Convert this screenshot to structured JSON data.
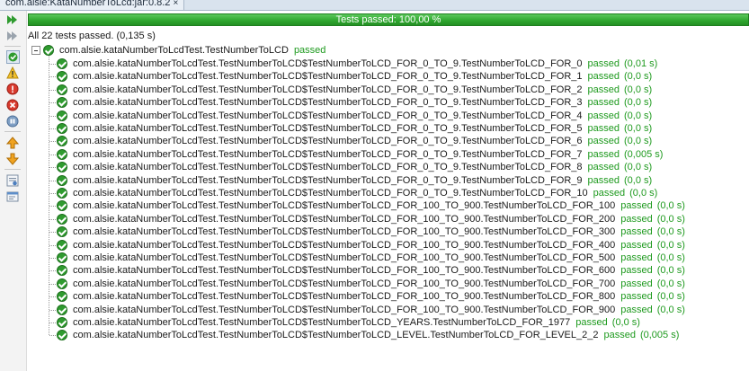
{
  "tab": {
    "title": "com.alsie:KataNumberToLcd:jar:0.8.2",
    "close": "×"
  },
  "progress": {
    "label": "Tests passed: 100,00 %",
    "fraction": 1.0,
    "color": "#2ea62e"
  },
  "summary": "All 22 tests passed. (0,135 s)",
  "suite": {
    "name": "com.alsie.kataNumberToLcdTest.TestNumberToLCD",
    "status": "passed"
  },
  "tests": [
    {
      "name": "com.alsie.kataNumberToLcdTest.TestNumberToLCD$TestNumberToLCD_FOR_0_TO_9.TestNumberToLCD_FOR_0",
      "status": "passed",
      "time": "(0,01 s)"
    },
    {
      "name": "com.alsie.kataNumberToLcdTest.TestNumberToLCD$TestNumberToLCD_FOR_0_TO_9.TestNumberToLCD_FOR_1",
      "status": "passed",
      "time": "(0,0 s)"
    },
    {
      "name": "com.alsie.kataNumberToLcdTest.TestNumberToLCD$TestNumberToLCD_FOR_0_TO_9.TestNumberToLCD_FOR_2",
      "status": "passed",
      "time": "(0,0 s)"
    },
    {
      "name": "com.alsie.kataNumberToLcdTest.TestNumberToLCD$TestNumberToLCD_FOR_0_TO_9.TestNumberToLCD_FOR_3",
      "status": "passed",
      "time": "(0,0 s)"
    },
    {
      "name": "com.alsie.kataNumberToLcdTest.TestNumberToLCD$TestNumberToLCD_FOR_0_TO_9.TestNumberToLCD_FOR_4",
      "status": "passed",
      "time": "(0,0 s)"
    },
    {
      "name": "com.alsie.kataNumberToLcdTest.TestNumberToLCD$TestNumberToLCD_FOR_0_TO_9.TestNumberToLCD_FOR_5",
      "status": "passed",
      "time": "(0,0 s)"
    },
    {
      "name": "com.alsie.kataNumberToLcdTest.TestNumberToLCD$TestNumberToLCD_FOR_0_TO_9.TestNumberToLCD_FOR_6",
      "status": "passed",
      "time": "(0,0 s)"
    },
    {
      "name": "com.alsie.kataNumberToLcdTest.TestNumberToLCD$TestNumberToLCD_FOR_0_TO_9.TestNumberToLCD_FOR_7",
      "status": "passed",
      "time": "(0,005 s)"
    },
    {
      "name": "com.alsie.kataNumberToLcdTest.TestNumberToLCD$TestNumberToLCD_FOR_0_TO_9.TestNumberToLCD_FOR_8",
      "status": "passed",
      "time": "(0,0 s)"
    },
    {
      "name": "com.alsie.kataNumberToLcdTest.TestNumberToLCD$TestNumberToLCD_FOR_0_TO_9.TestNumberToLCD_FOR_9",
      "status": "passed",
      "time": "(0,0 s)"
    },
    {
      "name": "com.alsie.kataNumberToLcdTest.TestNumberToLCD$TestNumberToLCD_FOR_0_TO_9.TestNumberToLCD_FOR_10",
      "status": "passed",
      "time": "(0,0 s)"
    },
    {
      "name": "com.alsie.kataNumberToLcdTest.TestNumberToLCD$TestNumberToLCD_FOR_100_TO_900.TestNumberToLCD_FOR_100",
      "status": "passed",
      "time": "(0,0 s)"
    },
    {
      "name": "com.alsie.kataNumberToLcdTest.TestNumberToLCD$TestNumberToLCD_FOR_100_TO_900.TestNumberToLCD_FOR_200",
      "status": "passed",
      "time": "(0,0 s)"
    },
    {
      "name": "com.alsie.kataNumberToLcdTest.TestNumberToLCD$TestNumberToLCD_FOR_100_TO_900.TestNumberToLCD_FOR_300",
      "status": "passed",
      "time": "(0,0 s)"
    },
    {
      "name": "com.alsie.kataNumberToLcdTest.TestNumberToLCD$TestNumberToLCD_FOR_100_TO_900.TestNumberToLCD_FOR_400",
      "status": "passed",
      "time": "(0,0 s)"
    },
    {
      "name": "com.alsie.kataNumberToLcdTest.TestNumberToLCD$TestNumberToLCD_FOR_100_TO_900.TestNumberToLCD_FOR_500",
      "status": "passed",
      "time": "(0,0 s)"
    },
    {
      "name": "com.alsie.kataNumberToLcdTest.TestNumberToLCD$TestNumberToLCD_FOR_100_TO_900.TestNumberToLCD_FOR_600",
      "status": "passed",
      "time": "(0,0 s)"
    },
    {
      "name": "com.alsie.kataNumberToLcdTest.TestNumberToLCD$TestNumberToLCD_FOR_100_TO_900.TestNumberToLCD_FOR_700",
      "status": "passed",
      "time": "(0,0 s)"
    },
    {
      "name": "com.alsie.kataNumberToLcdTest.TestNumberToLCD$TestNumberToLCD_FOR_100_TO_900.TestNumberToLCD_FOR_800",
      "status": "passed",
      "time": "(0,0 s)"
    },
    {
      "name": "com.alsie.kataNumberToLcdTest.TestNumberToLCD$TestNumberToLCD_FOR_100_TO_900.TestNumberToLCD_FOR_900",
      "status": "passed",
      "time": "(0,0 s)"
    },
    {
      "name": "com.alsie.kataNumberToLcdTest.TestNumberToLCD$TestNumberToLCD_YEARS.TestNumberToLCD_FOR_1977",
      "status": "passed",
      "time": "(0,0 s)"
    },
    {
      "name": "com.alsie.kataNumberToLcdTest.TestNumberToLCD$TestNumberToLCD_LEVEL.TestNumberToLCD_FOR_LEVEL_2_2",
      "status": "passed",
      "time": "(0,005 s)"
    }
  ],
  "toolbar": [
    {
      "icon": "rerun-icon"
    },
    {
      "icon": "rerun-failed-icon"
    },
    {
      "icon": "show-passed-icon"
    },
    {
      "icon": "show-warnings-icon"
    },
    {
      "icon": "show-failures-icon"
    },
    {
      "icon": "show-errors-icon"
    },
    {
      "icon": "show-aborted-icon"
    },
    {
      "icon": "previous-failure-icon"
    },
    {
      "icon": "next-failure-icon"
    },
    {
      "icon": "show-output-icon"
    },
    {
      "icon": "show-statistics-icon"
    }
  ]
}
